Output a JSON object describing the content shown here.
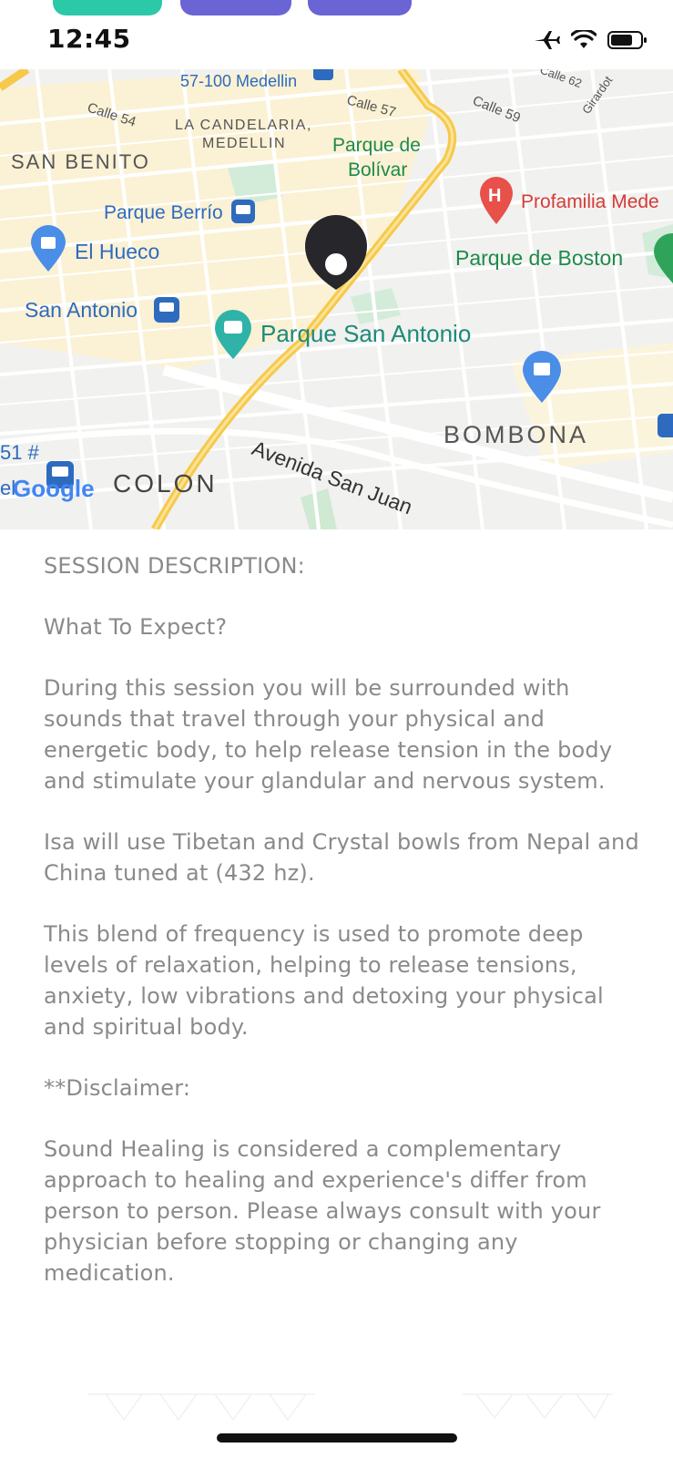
{
  "status_bar": {
    "time": "12:45"
  },
  "map": {
    "labels": {
      "transit_top": "57-100 Medellin",
      "calle54": "Calle 54",
      "calle57": "Calle 57",
      "calle59": "Calle 59",
      "calle62": "Calle 62",
      "girardot": "Girardot",
      "candelaria1": "LA CANDELARIA,",
      "candelaria2": "MEDELLIN",
      "san_benito": "SAN BENITO",
      "parque_bolivar1": "Parque de",
      "parque_bolivar2": "Bolívar",
      "profamilia": "Profamilia Mede",
      "parque_berrio": "Parque Berrío",
      "el_hueco": "El Hueco",
      "parque_boston": "Parque de Boston",
      "san_antonio": "San Antonio",
      "parque_san_antonio": "Parque San Antonio",
      "bombona": "BOMBONA",
      "avenida_san_juan": "Avenida San Juan",
      "colon": "COLON",
      "edge_51": "51 #",
      "edge_el": "el",
      "google": "Google"
    }
  },
  "description": {
    "heading": "SESSION DESCRIPTION:",
    "subheading": "What To Expect?",
    "para1": "During this session you will be surrounded with sounds that travel through your physical and energetic body, to help release tension in the body and stimulate your glandular and nervous system.",
    "para2": "Isa will use Tibetan and Crystal bowls from Nepal and China tuned at (432 hz).",
    "para3": "This blend of frequency is used to promote deep levels of relaxation, helping to release tensions, anxiety, low vibrations and detoxing your physical and spiritual body.",
    "disclaimer_label": "**Disclaimer:",
    "disclaimer_text": "Sound Healing is considered a complementary approach to healing and experience's differ from person to person. Please always consult with your physician before stopping or changing any medication."
  },
  "colors": {
    "pill_green": "#2cc9a8",
    "pill_purple": "#6a64d4",
    "text_gray": "#8a8a8a",
    "map_green_label": "#1e8a4a",
    "map_blue_label": "#2e6bbf"
  },
  "icons": [
    "airplane-icon",
    "wifi-icon",
    "battery-icon",
    "location-pin-icon",
    "transit-icon",
    "shopping-icon",
    "hospital-icon",
    "camera-icon",
    "park-icon"
  ]
}
